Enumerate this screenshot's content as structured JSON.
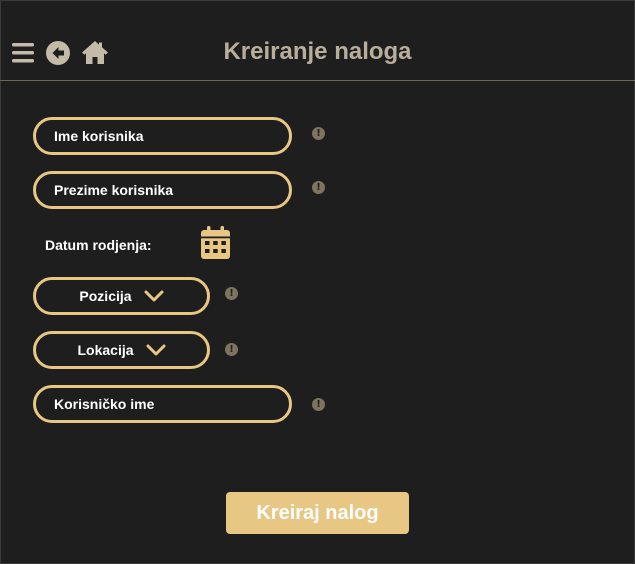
{
  "header": {
    "title": "Kreiranje naloga",
    "icons": [
      "menu-icon",
      "back-icon",
      "home-icon"
    ]
  },
  "form": {
    "first_name_placeholder": "Ime korisnika",
    "last_name_placeholder": "Prezime korisnika",
    "birth_date_label": "Datum rodjenja:",
    "position_label": "Pozicija",
    "location_label": "Lokacija",
    "username_placeholder": "Korisničko ime",
    "info_glyph": "!",
    "submit_label": "Kreiraj nalog"
  },
  "colors": {
    "background": "#1e1e1e",
    "accent": "#e8c684",
    "header_text": "#b9ad9b",
    "icon": "#c4baa8",
    "info_icon": "#7d735f"
  }
}
